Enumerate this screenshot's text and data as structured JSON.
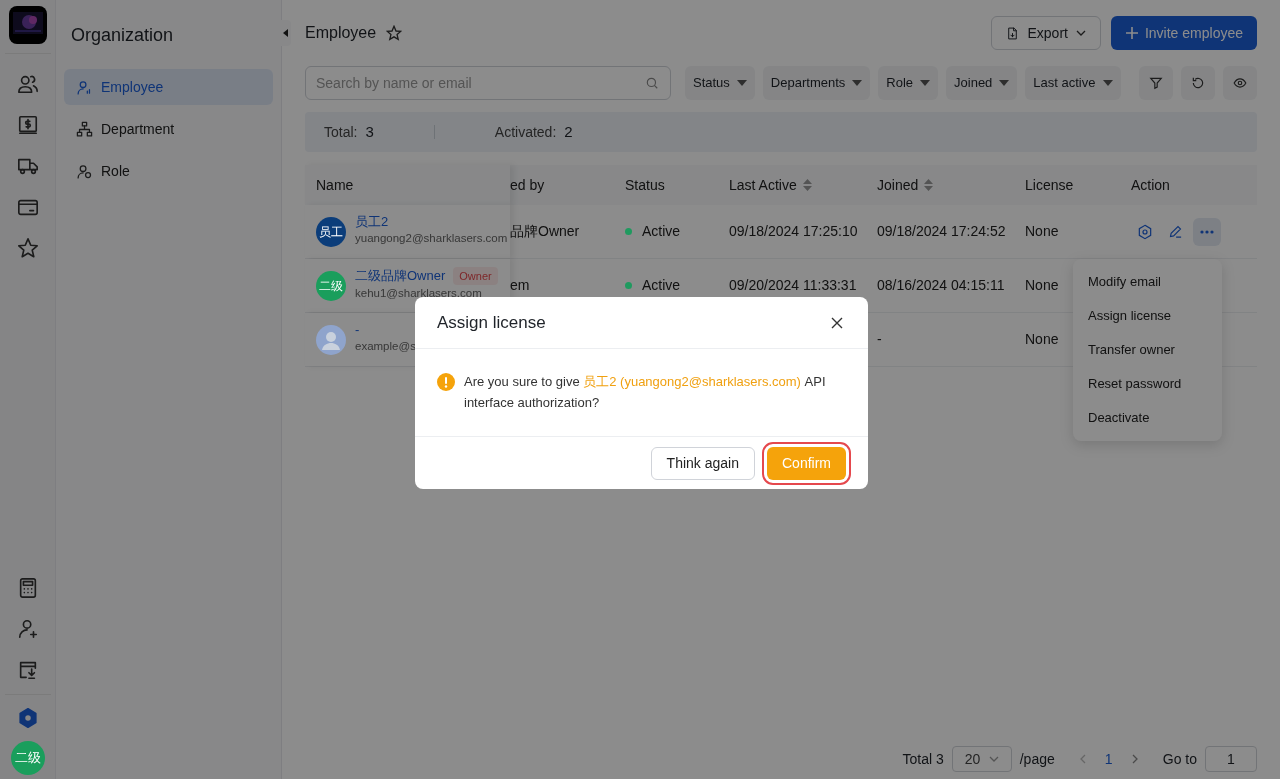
{
  "rail": {
    "top_items": [
      {
        "kind": "people",
        "selected": false
      },
      {
        "kind": "billing",
        "selected": false
      },
      {
        "kind": "truck",
        "selected": false
      },
      {
        "kind": "card",
        "selected": false
      },
      {
        "kind": "star",
        "selected": false
      }
    ],
    "bottom_items": [
      {
        "kind": "calculator",
        "selected": false
      },
      {
        "kind": "add-user",
        "selected": false
      },
      {
        "kind": "download",
        "selected": false
      },
      {
        "kind": "settings",
        "selected": true
      }
    ],
    "avatar": {
      "text": "二级",
      "color": "#1a9e5c"
    }
  },
  "sidebar": {
    "title": "Organization",
    "items": [
      {
        "label": "Employee",
        "kind": "employee",
        "selected": true
      },
      {
        "label": "Department",
        "kind": "department",
        "selected": false
      },
      {
        "label": "Role",
        "kind": "role",
        "selected": false
      }
    ]
  },
  "header": {
    "title": "Employee",
    "export": "Export",
    "invite": "Invite employee"
  },
  "search": {
    "placeholder": "Search by name or email"
  },
  "filters": [
    "Status",
    "Departments",
    "Role",
    "Joined",
    "Last active"
  ],
  "stats": [
    {
      "label": "Total:",
      "value": "3"
    },
    {
      "label": "Activated:",
      "value": "2"
    }
  ],
  "table": {
    "columns": [
      {
        "label": "Name",
        "sortable": false
      },
      {
        "label": "ed by",
        "sortable": false
      },
      {
        "label": "Status",
        "sortable": false
      },
      {
        "label": "Last Active",
        "sortable": true
      },
      {
        "label": "Joined",
        "sortable": true
      },
      {
        "label": "License",
        "sortable": false
      },
      {
        "label": "Action",
        "sortable": false
      }
    ],
    "rows": [
      {
        "avatar": {
          "kind": "initials",
          "text": "员工",
          "color": "#0b3d7a"
        },
        "name": "员工2",
        "badge": "",
        "email": "yuangong2@sharklasers.com",
        "created_by": "品牌Owner",
        "status": {
          "label": "Active",
          "color": "#1f9a5f"
        },
        "last_active": "09/18/2024 17:25:10",
        "joined": "09/18/2024 17:24:52",
        "license": "None",
        "show_actions": true,
        "menu_open": true
      },
      {
        "avatar": {
          "kind": "initials",
          "text": "二级",
          "color": "#1a9e5c"
        },
        "name": "二级品牌Owner",
        "badge": "Owner",
        "email": "kehu1@sharklasers.com",
        "created_by": "em",
        "status": {
          "label": "Active",
          "color": "#1f9a5f"
        },
        "last_active": "09/20/2024 11:33:31",
        "joined": "08/16/2024 04:15:11",
        "license": "None",
        "show_actions": false,
        "menu_open": false
      },
      {
        "avatar": {
          "kind": "silhouette",
          "color": "#8fa4cc"
        },
        "name": "-",
        "badge": "",
        "email": "example@s",
        "created_by": "",
        "last_active": "",
        "joined": "-",
        "license": "None",
        "show_actions": false,
        "menu_open": false
      }
    ]
  },
  "menu": [
    "Modify email",
    "Assign license",
    "Transfer owner",
    "Reset password",
    "Deactivate"
  ],
  "pagination": {
    "total": "Total 3",
    "page_size": "20",
    "per_page": "/page",
    "pages": [
      {
        "label": "1",
        "selected": true
      }
    ],
    "goto_label": "Go to",
    "goto_value": "1"
  },
  "dialog": {
    "title": "Assign license",
    "message": {
      "before": "Are you sure to give ",
      "highlight": "员工2 (yuangong2@sharklasers.com)",
      "after": " API interface authorization?"
    },
    "buttons": [
      {
        "label": "Think again",
        "kind": "secondary",
        "highlighted": false
      },
      {
        "label": "Confirm",
        "kind": "primary",
        "highlighted": true
      }
    ]
  }
}
